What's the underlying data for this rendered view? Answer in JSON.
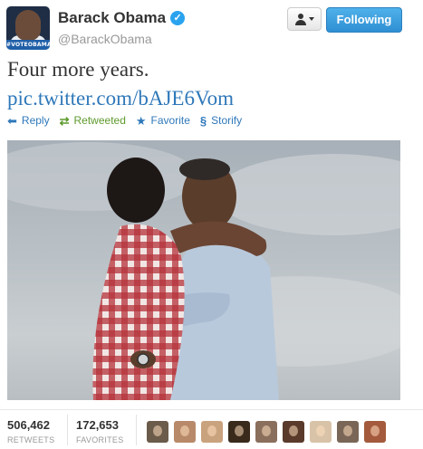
{
  "profile": {
    "display_name": "Barack Obama",
    "handle": "@BarackObama",
    "avatar_banner_text": "#VOTEOBAMA",
    "verified_icon": "verified-badge-icon"
  },
  "header_buttons": {
    "following_label": "Following",
    "user_menu_icon": "user-dropdown-icon"
  },
  "tweet": {
    "text": "Four more years.",
    "link": "pic.twitter.com/bAJE6Vom"
  },
  "actions": [
    {
      "label": "Reply",
      "icon": "reply-icon"
    },
    {
      "label": "Retweeted",
      "icon": "retweet-icon"
    },
    {
      "label": "Favorite",
      "icon": "star-icon"
    },
    {
      "label": "Storify",
      "icon": "storify-icon"
    }
  ],
  "stats": {
    "retweets": {
      "count": "506,462",
      "label": "RETWEETS"
    },
    "favorites": {
      "count": "172,653",
      "label": "FAVORITES"
    }
  },
  "colors": {
    "link": "#2f78b9",
    "retweeted": "#5e9a2c",
    "following_button": "#3a9de0"
  },
  "favoriter_avatars": [
    "#6b5b4a",
    "#b88a6a",
    "#c9a37e",
    "#3a2a1c",
    "#8a6f5c",
    "#5a3a2a",
    "#d8c3a8",
    "#7a6656",
    "#a45a3c"
  ]
}
